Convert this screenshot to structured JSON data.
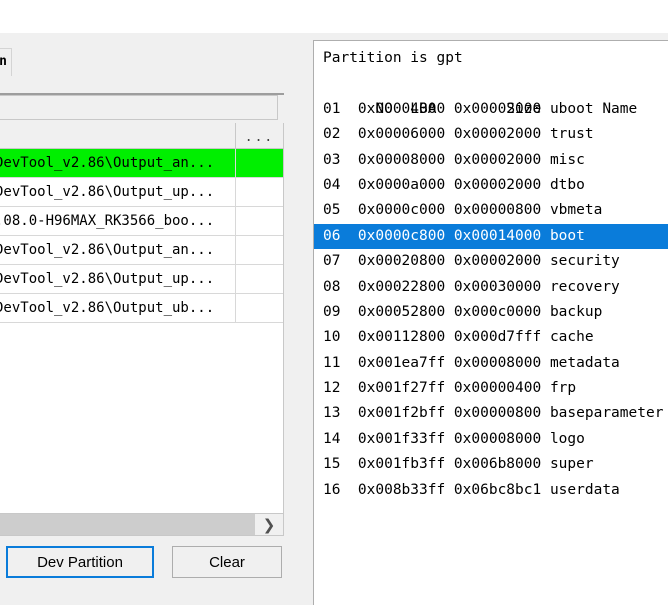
{
  "window": {
    "background_color": "#f0f0f0",
    "accent_color": "#0a7cda",
    "selected_row_color": "#00ef00"
  },
  "left_pane": {
    "tab": {
      "clipped_label": "n"
    },
    "path_field": {
      "value": "",
      "placeholder": ""
    },
    "file_list": {
      "columns": [
        "",
        "..."
      ],
      "rows": [
        {
          "path": "DevTool_v2.86\\Output_an...",
          "action": "",
          "selected": true
        },
        {
          "path": "DevTool_v2.86\\Output_up...",
          "action": "",
          "selected": false
        },
        {
          "path": ".08.0-H96MAX_RK3566_boo...",
          "action": "",
          "selected": false
        },
        {
          "path": "DevTool_v2.86\\Output_an...",
          "action": "",
          "selected": false
        },
        {
          "path": "DevTool_v2.86\\Output_up...",
          "action": "",
          "selected": false
        },
        {
          "path": "DevTool_v2.86\\Output_ub...",
          "action": "",
          "selected": false
        }
      ],
      "scroll_right_glyph": "❯"
    },
    "buttons": {
      "dev_partition": "Dev Partition",
      "clear": "Clear"
    }
  },
  "partition_panel": {
    "title_line": "Partition is gpt",
    "header": {
      "no": "NO",
      "lba": "LBA",
      "size": "Size",
      "name": "Name"
    },
    "rows": [
      {
        "no": "01",
        "lba": "0x00004000",
        "size": "0x00002000",
        "name": "uboot",
        "highlight": false
      },
      {
        "no": "02",
        "lba": "0x00006000",
        "size": "0x00002000",
        "name": "trust",
        "highlight": false
      },
      {
        "no": "03",
        "lba": "0x00008000",
        "size": "0x00002000",
        "name": "misc",
        "highlight": false
      },
      {
        "no": "04",
        "lba": "0x0000a000",
        "size": "0x00002000",
        "name": "dtbo",
        "highlight": false
      },
      {
        "no": "05",
        "lba": "0x0000c000",
        "size": "0x00000800",
        "name": "vbmeta",
        "highlight": false
      },
      {
        "no": "06",
        "lba": "0x0000c800",
        "size": "0x00014000",
        "name": "boot",
        "highlight": true
      },
      {
        "no": "07",
        "lba": "0x00020800",
        "size": "0x00002000",
        "name": "security",
        "highlight": false
      },
      {
        "no": "08",
        "lba": "0x00022800",
        "size": "0x00030000",
        "name": "recovery",
        "highlight": false
      },
      {
        "no": "09",
        "lba": "0x00052800",
        "size": "0x000c0000",
        "name": "backup",
        "highlight": false
      },
      {
        "no": "10",
        "lba": "0x00112800",
        "size": "0x000d7fff",
        "name": "cache",
        "highlight": false
      },
      {
        "no": "11",
        "lba": "0x001ea7ff",
        "size": "0x00008000",
        "name": "metadata",
        "highlight": false
      },
      {
        "no": "12",
        "lba": "0x001f27ff",
        "size": "0x00000400",
        "name": "frp",
        "highlight": false
      },
      {
        "no": "13",
        "lba": "0x001f2bff",
        "size": "0x00000800",
        "name": "baseparameter",
        "highlight": false
      },
      {
        "no": "14",
        "lba": "0x001f33ff",
        "size": "0x00008000",
        "name": "logo",
        "highlight": false
      },
      {
        "no": "15",
        "lba": "0x001fb3ff",
        "size": "0x006b8000",
        "name": "super",
        "highlight": false
      },
      {
        "no": "16",
        "lba": "0x008b33ff",
        "size": "0x06bc8bc1",
        "name": "userdata",
        "highlight": false
      }
    ]
  }
}
